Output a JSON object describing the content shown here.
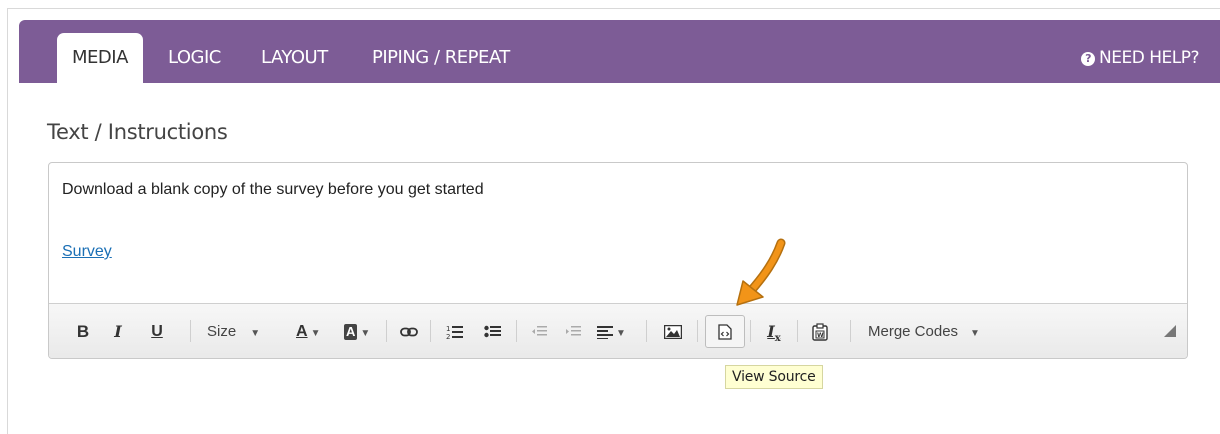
{
  "tabs": {
    "items": [
      {
        "label": "MEDIA",
        "active": true
      },
      {
        "label": "LOGIC",
        "active": false
      },
      {
        "label": "LAYOUT",
        "active": false
      },
      {
        "label": "PIPING / REPEAT",
        "active": false
      }
    ],
    "help_label": "NEED HELP?",
    "help_icon": "question-circle-icon"
  },
  "colors": {
    "tab_bar": "#7d5c96",
    "link": "#1a6fb5",
    "tooltip_bg": "#ffffd2",
    "arrow": "#f29418"
  },
  "section": {
    "title": "Text / Instructions"
  },
  "editor": {
    "body_text": "Download a blank copy of the survey before you get started",
    "link_text": "Survey",
    "toolbar": {
      "bold": "B",
      "italic": "I",
      "underline": "U",
      "size_label": "Size",
      "text_color": "A",
      "bg_color": "A",
      "merge_codes_label": "Merge Codes",
      "icons": [
        "bold-icon",
        "italic-icon",
        "underline-icon",
        "text-color-icon",
        "background-color-icon",
        "link-icon",
        "numbered-list-icon",
        "bulleted-list-icon",
        "outdent-icon",
        "indent-icon",
        "align-icon",
        "image-icon",
        "view-source-icon",
        "remove-format-icon",
        "paste-from-word-icon"
      ]
    }
  },
  "tooltip": {
    "text": "View Source"
  }
}
